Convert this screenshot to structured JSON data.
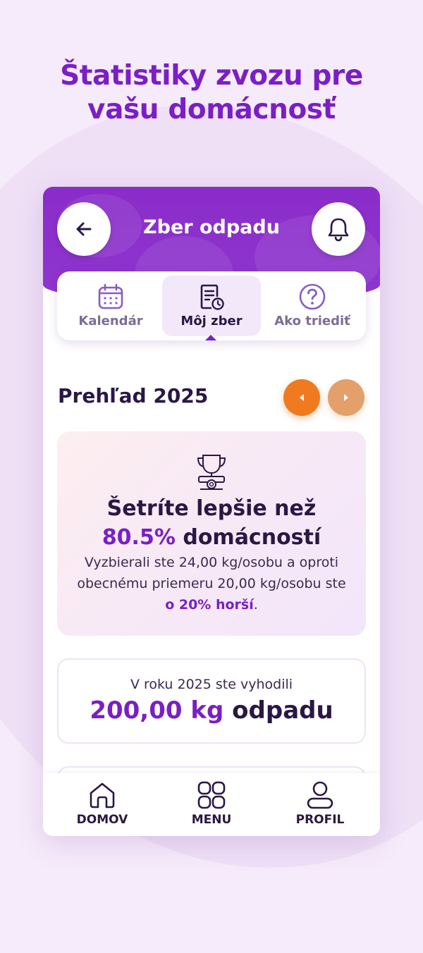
{
  "promo": {
    "title": "Štatistiky zvozu pre\nvašu domácnosť"
  },
  "app": {
    "title": "Zber odpadu",
    "back_icon": "arrow-left-icon",
    "bell_icon": "bell-icon"
  },
  "tabs": [
    {
      "label": "Kalendár",
      "icon": "calendar-icon",
      "active": false
    },
    {
      "label": "Môj zber",
      "icon": "document-clock-icon",
      "active": true
    },
    {
      "label": "Ako triediť",
      "icon": "question-icon",
      "active": false
    }
  ],
  "overview": {
    "title": "Prehľad 2025",
    "prev_icon": "caret-left-icon",
    "next_icon": "caret-right-icon"
  },
  "stat_card": {
    "icon": "trophy-icon",
    "headline_1": "Šetríte lepšie než",
    "percent": "80.5%",
    "headline_2": "domácností",
    "desc_1": "Vyzbierali ste 24,00 kg/osobu a oproti obecnému priemeru 20,00 kg/osobu ste ",
    "desc_highlight": "o 20% horší",
    "desc_2": "."
  },
  "total_card": {
    "subtitle": "V roku 2025 ste vyhodili",
    "value": "200,00 kg",
    "unit": "odpadu"
  },
  "bottom_nav": [
    {
      "label": "DOMOV",
      "icon": "home-icon"
    },
    {
      "label": "MENU",
      "icon": "grid-icon"
    },
    {
      "label": "PROFIL",
      "icon": "user-icon"
    }
  ],
  "colors": {
    "brand_purple": "#7a1fc4",
    "header_purple": "#8a2cc9",
    "orange_active": "#f07a1e",
    "orange_muted": "#e3a06a",
    "dark_text": "#2a1744",
    "background": "#f6ebfa"
  }
}
